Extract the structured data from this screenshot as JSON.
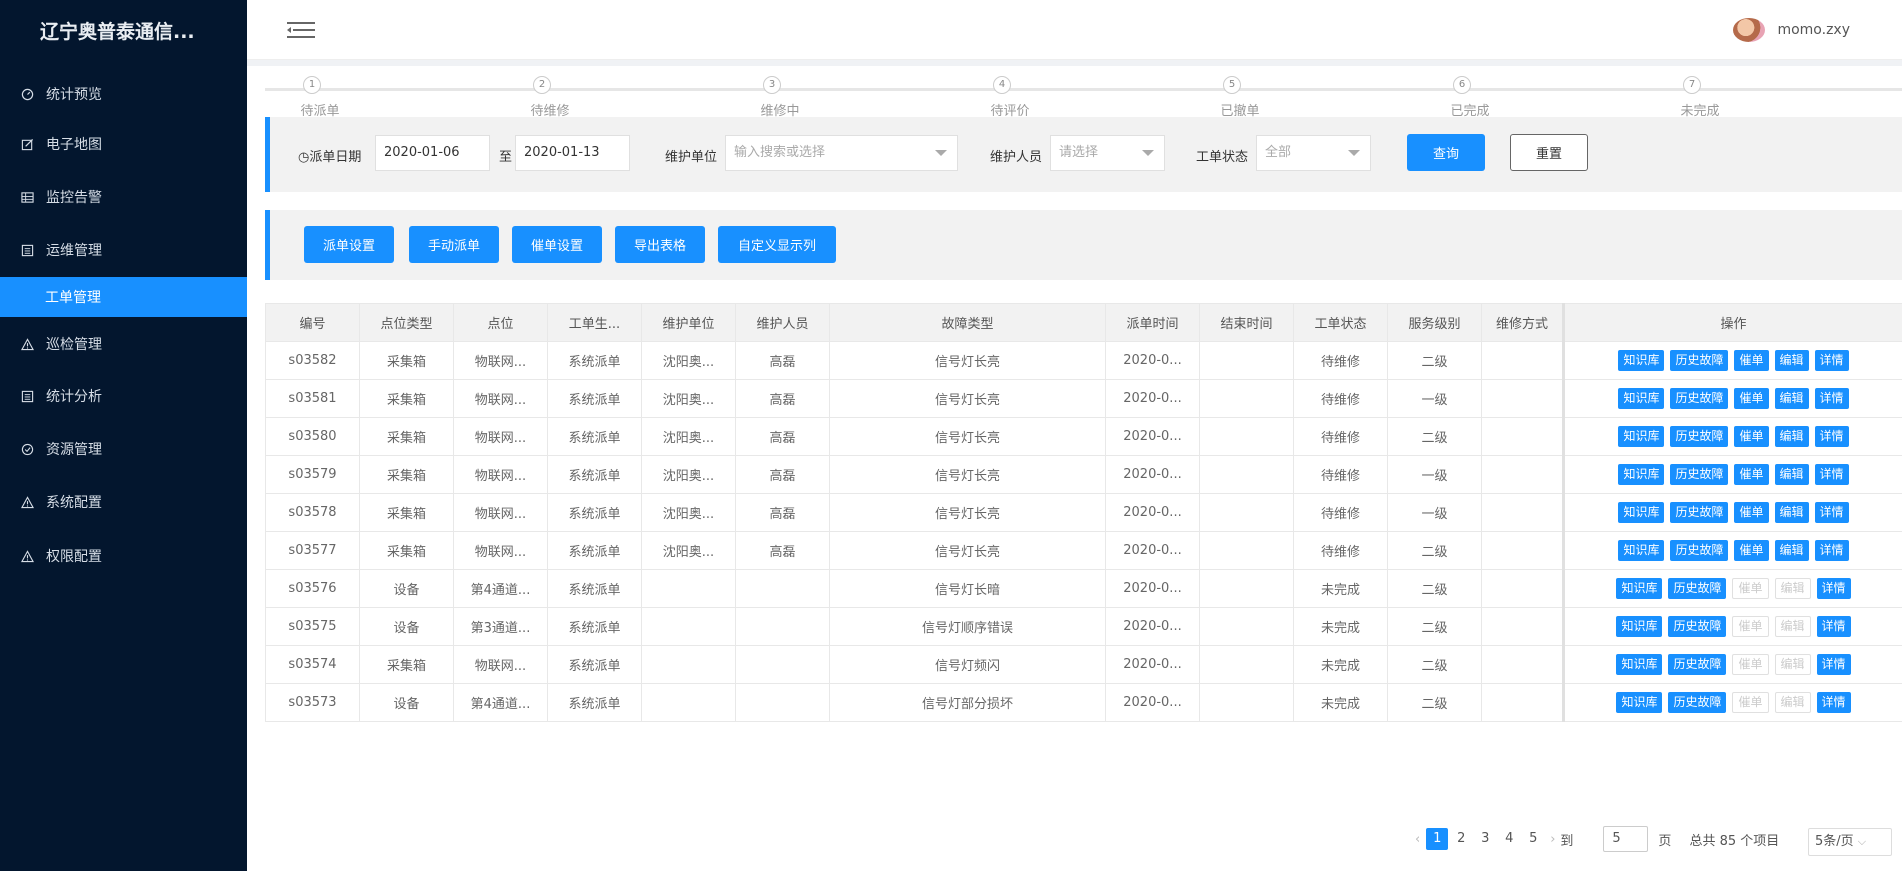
{
  "brand": "辽宁奥普泰通信...",
  "user": {
    "name": "momo.zxy"
  },
  "sidebar": {
    "items": [
      {
        "label": "统计预览",
        "icon": "dashboard-icon"
      },
      {
        "label": "电子地图",
        "icon": "edit-icon"
      },
      {
        "label": "监控告警",
        "icon": "table-icon"
      },
      {
        "label": "运维管理",
        "icon": "list-icon"
      },
      {
        "label": "工单管理",
        "icon": ""
      },
      {
        "label": "巡检管理",
        "icon": "warning-icon"
      },
      {
        "label": "统计分析",
        "icon": "list-icon"
      },
      {
        "label": "资源管理",
        "icon": "check-circle-icon"
      },
      {
        "label": "系统配置",
        "icon": "warning-icon"
      },
      {
        "label": "权限配置",
        "icon": "warning-icon"
      }
    ]
  },
  "steps": [
    {
      "num": "1",
      "label": "待派单"
    },
    {
      "num": "2",
      "label": "待维修"
    },
    {
      "num": "3",
      "label": "维修中"
    },
    {
      "num": "4",
      "label": "待评价"
    },
    {
      "num": "5",
      "label": "已撤单"
    },
    {
      "num": "6",
      "label": "已完成"
    },
    {
      "num": "7",
      "label": "未完成"
    }
  ],
  "filter": {
    "date_label": "派单日期",
    "date_start": "2020-01-06",
    "date_sep": "至",
    "date_end": "2020-01-13",
    "unit_label": "维护单位",
    "unit_placeholder": "输入搜索或选择",
    "staff_label": "维护人员",
    "staff_placeholder": "请选择",
    "status_label": "工单状态",
    "status_value": "全部",
    "query": "查询",
    "reset": "重置"
  },
  "actions": [
    "派单设置",
    "手动派单",
    "催单设置",
    "导出表格",
    "自定义显示列"
  ],
  "table": {
    "headers": [
      "编号",
      "点位类型",
      "点位",
      "工单生...",
      "维护单位",
      "维护人员",
      "故障类型",
      "派单时间",
      "结束时间",
      "工单状态",
      "服务级别",
      "维修方式",
      "操作"
    ],
    "ops": [
      "知识库",
      "历史故障",
      "催单",
      "编辑",
      "详情"
    ],
    "rows": [
      {
        "id": "s03582",
        "type": "采集箱",
        "point": "物联网...",
        "gen": "系统派单",
        "unit": "沈阳奥...",
        "staff": "高磊",
        "fault": "信号灯长亮",
        "time": "2020-0...",
        "end": "",
        "status": "待维修",
        "level": "二级",
        "method": "",
        "enabled": true
      },
      {
        "id": "s03581",
        "type": "采集箱",
        "point": "物联网...",
        "gen": "系统派单",
        "unit": "沈阳奥...",
        "staff": "高磊",
        "fault": "信号灯长亮",
        "time": "2020-0...",
        "end": "",
        "status": "待维修",
        "level": "一级",
        "method": "",
        "enabled": true
      },
      {
        "id": "s03580",
        "type": "采集箱",
        "point": "物联网...",
        "gen": "系统派单",
        "unit": "沈阳奥...",
        "staff": "高磊",
        "fault": "信号灯长亮",
        "time": "2020-0...",
        "end": "",
        "status": "待维修",
        "level": "二级",
        "method": "",
        "enabled": true
      },
      {
        "id": "s03579",
        "type": "采集箱",
        "point": "物联网...",
        "gen": "系统派单",
        "unit": "沈阳奥...",
        "staff": "高磊",
        "fault": "信号灯长亮",
        "time": "2020-0...",
        "end": "",
        "status": "待维修",
        "level": "一级",
        "method": "",
        "enabled": true
      },
      {
        "id": "s03578",
        "type": "采集箱",
        "point": "物联网...",
        "gen": "系统派单",
        "unit": "沈阳奥...",
        "staff": "高磊",
        "fault": "信号灯长亮",
        "time": "2020-0...",
        "end": "",
        "status": "待维修",
        "level": "一级",
        "method": "",
        "enabled": true
      },
      {
        "id": "s03577",
        "type": "采集箱",
        "point": "物联网...",
        "gen": "系统派单",
        "unit": "沈阳奥...",
        "staff": "高磊",
        "fault": "信号灯长亮",
        "time": "2020-0...",
        "end": "",
        "status": "待维修",
        "level": "二级",
        "method": "",
        "enabled": true
      },
      {
        "id": "s03576",
        "type": "设备",
        "point": "第4通道...",
        "gen": "系统派单",
        "unit": "",
        "staff": "",
        "fault": "信号灯长暗",
        "time": "2020-0...",
        "end": "",
        "status": "未完成",
        "level": "二级",
        "method": "",
        "enabled": false
      },
      {
        "id": "s03575",
        "type": "设备",
        "point": "第3通道...",
        "gen": "系统派单",
        "unit": "",
        "staff": "",
        "fault": "信号灯顺序错误",
        "time": "2020-0...",
        "end": "",
        "status": "未完成",
        "level": "二级",
        "method": "",
        "enabled": false
      },
      {
        "id": "s03574",
        "type": "采集箱",
        "point": "物联网...",
        "gen": "系统派单",
        "unit": "",
        "staff": "",
        "fault": "信号灯频闪",
        "time": "2020-0...",
        "end": "",
        "status": "未完成",
        "level": "二级",
        "method": "",
        "enabled": false
      },
      {
        "id": "s03573",
        "type": "设备",
        "point": "第4通道...",
        "gen": "系统派单",
        "unit": "",
        "staff": "",
        "fault": "信号灯部分损坏",
        "time": "2020-0...",
        "end": "",
        "status": "未完成",
        "level": "二级",
        "method": "",
        "enabled": false
      }
    ]
  },
  "pagination": {
    "pages": [
      "1",
      "2",
      "3",
      "4",
      "5"
    ],
    "current": "1",
    "goto_label": "到",
    "goto_value": "5",
    "page_unit": "页",
    "total": "总共 85 个项目",
    "page_size": "5条/页"
  },
  "colors": {
    "primary": "#1890ff",
    "sidebar": "#03162e"
  }
}
